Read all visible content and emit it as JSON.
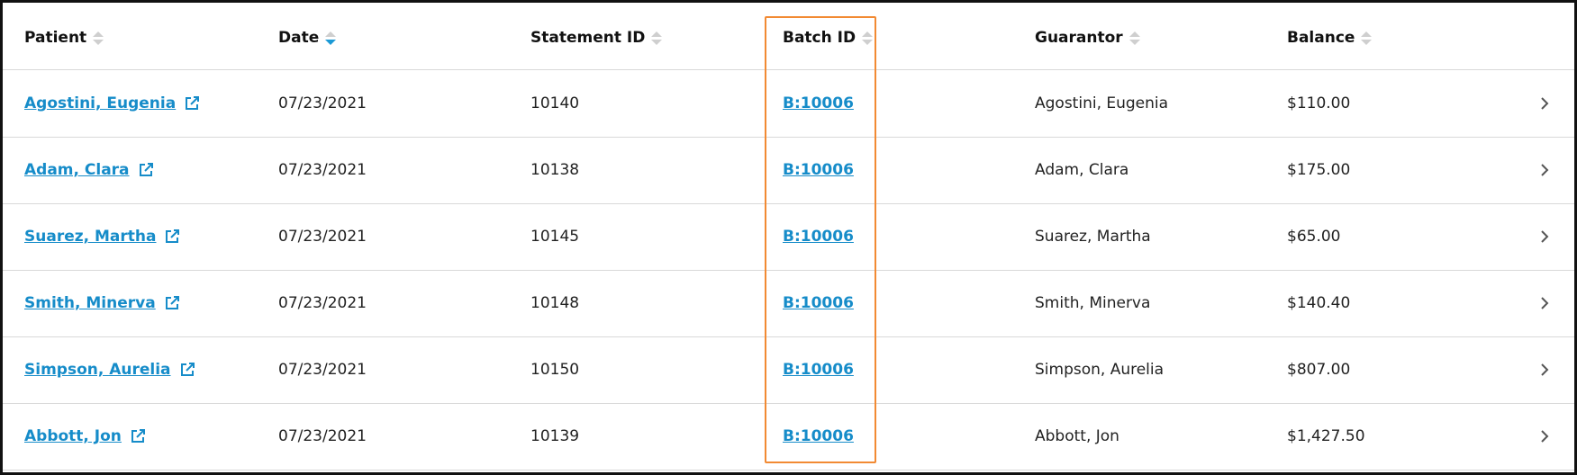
{
  "table": {
    "headers": {
      "patient": "Patient",
      "date": "Date",
      "statement_id": "Statement ID",
      "batch_id": "Batch ID",
      "guarantor": "Guarantor",
      "balance": "Balance"
    },
    "sorted_column": "date",
    "rows": [
      {
        "patient": "Agostini, Eugenia",
        "date": "07/23/2021",
        "statement_id": "10140",
        "batch_id": "B:10006",
        "guarantor": "Agostini, Eugenia",
        "balance": "$110.00"
      },
      {
        "patient": "Adam, Clara",
        "date": "07/23/2021",
        "statement_id": "10138",
        "batch_id": "B:10006",
        "guarantor": "Adam, Clara",
        "balance": "$175.00"
      },
      {
        "patient": "Suarez, Martha",
        "date": "07/23/2021",
        "statement_id": "10145",
        "batch_id": "B:10006",
        "guarantor": "Suarez, Martha",
        "balance": "$65.00"
      },
      {
        "patient": "Smith, Minerva",
        "date": "07/23/2021",
        "statement_id": "10148",
        "batch_id": "B:10006",
        "guarantor": "Smith, Minerva",
        "balance": "$140.40"
      },
      {
        "patient": "Simpson, Aurelia",
        "date": "07/23/2021",
        "statement_id": "10150",
        "batch_id": "B:10006",
        "guarantor": "Simpson, Aurelia",
        "balance": "$807.00"
      },
      {
        "patient": "Abbott, Jon",
        "date": "07/23/2021",
        "statement_id": "10139",
        "batch_id": "B:10006",
        "guarantor": "Abbott, Jon",
        "balance": "$1,427.50"
      }
    ]
  },
  "colors": {
    "link": "#168cc9",
    "sort_active": "#1c9ad6",
    "highlight": "#f28a33"
  }
}
